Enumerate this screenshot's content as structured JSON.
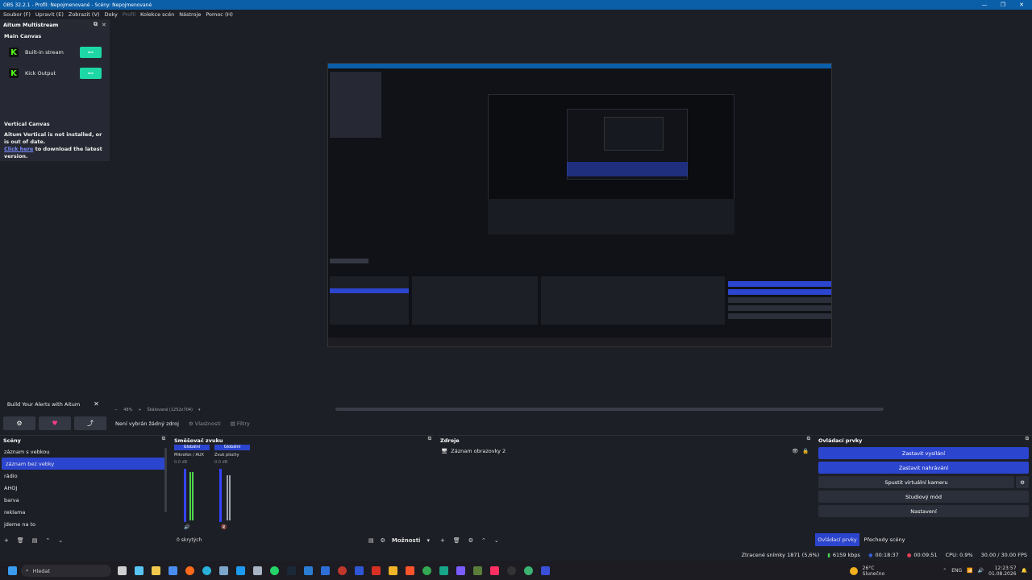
{
  "window": {
    "title": "OBS 32.2.1 - Profil: Nepojmenované - Scény: Nepojmenované",
    "min": "—",
    "max": "❐",
    "close": "✕"
  },
  "menu": [
    "Soubor (F)",
    "Upravit (E)",
    "Zobrazit (V)",
    "Doky",
    "Profil",
    "Kolekce scén",
    "Nástroje",
    "Pomoc (H)"
  ],
  "dock": {
    "title": "Aitum Multistream",
    "main_canvas": "Main Canvas",
    "outputs": [
      {
        "label": "Built-in stream",
        "logo": "K"
      },
      {
        "label": "Kick Output",
        "logo": "K"
      }
    ],
    "toggle_icon": "⊷",
    "vertical_canvas": "Vertical Canvas",
    "vertical_msg": "Aitum Vertical is not installed, or is out of date.",
    "click_here": "Click here",
    "download_msg": " to download the latest version.",
    "alerts_button": "Build Your Alerts with Aitum",
    "alerts_close": "✕"
  },
  "zoom": {
    "minus": "−",
    "percent": "48%",
    "plus": "+",
    "scale": "Škálované (1252x704)"
  },
  "props": {
    "no_source": "Není vybrán žádný zdroj",
    "properties": "Vlastnosti",
    "filters": "Filtry"
  },
  "scenes": {
    "title": "Scény",
    "items": [
      "záznam s vebkou",
      "záznam bez vebky",
      "rádio",
      "AHOJ",
      "barva",
      "reklama",
      "jdeme na to"
    ],
    "selected": 1
  },
  "mixer": {
    "title": "Směšovač zvuku",
    "channels": [
      {
        "global": "Globální",
        "name": "Mikrofon / AUX",
        "db": "0.0 dB"
      },
      {
        "global": "Globální",
        "name": "Zvuk plochy",
        "db": "0.0 dB"
      }
    ],
    "hidden": "0 skrytých",
    "options": "Možnosti"
  },
  "sources": {
    "title": "Zdroje",
    "items": [
      "Záznam obrazovky 2"
    ]
  },
  "controls": {
    "title": "Ovládací prvky",
    "buttons": [
      "Zastavit vysílání",
      "Zastavit nahrávání",
      "Spustit virtuální kameru",
      "Studiový mód",
      "Nastavení"
    ],
    "tabs": [
      "Ovládací prvky",
      "Přechody scény"
    ]
  },
  "status": {
    "dropped": "Ztracené snímky 1871 (5,6%)",
    "kbps": "6159 kbps",
    "stream_time": "00:18:37",
    "rec_time": "00:09:51",
    "cpu": "CPU: 0.9%",
    "fps": "30.00 / 30.00 FPS"
  },
  "taskbar": {
    "search": "Hledat",
    "weather_temp": "26°C",
    "weather_desc": "Slunečno",
    "lang": "ENG",
    "time": "12:23:57",
    "date": "01.08.2026"
  },
  "colors": {
    "accent": "#2c45cf",
    "toggle": "#1dd8a6",
    "titlebar": "#0b5ea8",
    "kick": "#53fc18"
  }
}
